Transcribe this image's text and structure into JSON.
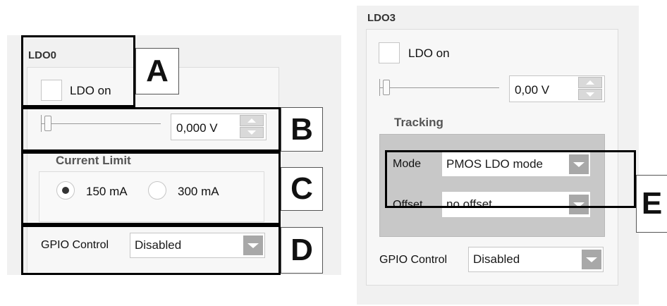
{
  "ldo0": {
    "title": "LDO0",
    "checkbox_label": "LDO on",
    "voltage_value": "0,000 V",
    "current_limit": {
      "title": "Current Limit",
      "options": [
        "150 mA",
        "300 mA"
      ],
      "selected": "150 mA"
    },
    "gpio": {
      "label": "GPIO Control",
      "value": "Disabled"
    }
  },
  "ldo3": {
    "title": "LDO3",
    "checkbox_label": "LDO on",
    "voltage_value": "0,00 V",
    "tracking": {
      "title": "Tracking",
      "mode_label": "Mode",
      "mode_value": "PMOS LDO mode",
      "offset_label": "Offset",
      "offset_value": "no offset"
    },
    "gpio": {
      "label": "GPIO Control",
      "value": "Disabled"
    }
  },
  "callouts": {
    "a": "A",
    "b": "B",
    "c": "C",
    "d": "D",
    "e": "E"
  },
  "colors": {
    "panel": "#f1f1f1",
    "dropdown_button": "#a8a8a8",
    "tracking_bg": "#c8c8c8",
    "box": "#000000"
  },
  "icons": [
    "checkbox",
    "slider-thumb",
    "spin-up-icon",
    "spin-down-icon",
    "chevron-down-icon",
    "radio-button"
  ]
}
